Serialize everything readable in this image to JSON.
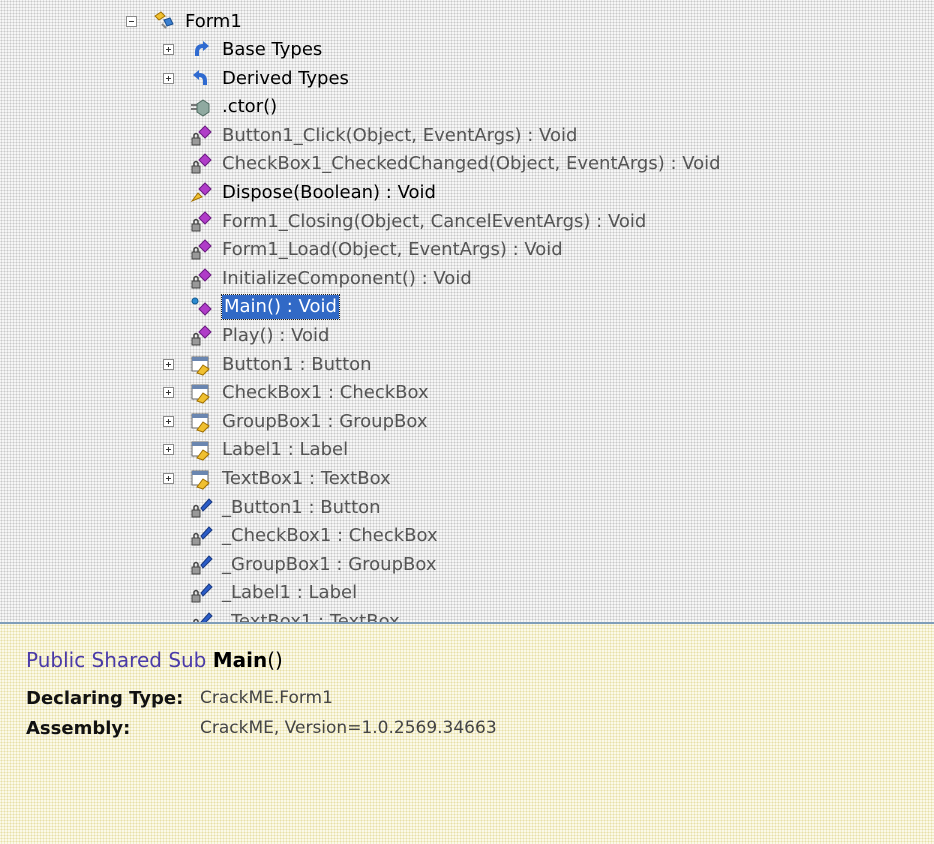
{
  "tree": {
    "root": {
      "label": "Form1",
      "icon": "class-icon",
      "expanded": true
    },
    "items": [
      {
        "label": "Base Types",
        "icon": "base-types-icon",
        "expander": "plus",
        "bold": true
      },
      {
        "label": "Derived Types",
        "icon": "derived-types-icon",
        "expander": "plus",
        "bold": true
      },
      {
        "label": ".ctor()",
        "icon": "constructor-icon",
        "bold": true
      },
      {
        "label": "Button1_Click(Object, EventArgs) : Void",
        "icon": "private-method-icon"
      },
      {
        "label": "CheckBox1_CheckedChanged(Object, EventArgs) : Void",
        "icon": "private-method-icon"
      },
      {
        "label": "Dispose(Boolean) : Void",
        "icon": "protected-method-icon",
        "bold": true
      },
      {
        "label": "Form1_Closing(Object, CancelEventArgs) : Void",
        "icon": "private-method-icon"
      },
      {
        "label": "Form1_Load(Object, EventArgs) : Void",
        "icon": "private-method-icon"
      },
      {
        "label": "InitializeComponent() : Void",
        "icon": "private-method-icon"
      },
      {
        "label": "Main() : Void",
        "icon": "static-method-icon",
        "selected": true
      },
      {
        "label": "Play() : Void",
        "icon": "private-method-icon"
      },
      {
        "label": "Button1 : Button",
        "icon": "property-icon",
        "expander": "plus"
      },
      {
        "label": "CheckBox1 : CheckBox",
        "icon": "property-icon",
        "expander": "plus"
      },
      {
        "label": "GroupBox1 : GroupBox",
        "icon": "property-icon",
        "expander": "plus"
      },
      {
        "label": "Label1 : Label",
        "icon": "property-icon",
        "expander": "plus"
      },
      {
        "label": "TextBox1 : TextBox",
        "icon": "property-icon",
        "expander": "plus"
      },
      {
        "label": "_Button1 : Button",
        "icon": "private-field-icon"
      },
      {
        "label": "_CheckBox1 : CheckBox",
        "icon": "private-field-icon"
      },
      {
        "label": "_GroupBox1 : GroupBox",
        "icon": "private-field-icon"
      },
      {
        "label": "_Label1 : Label",
        "icon": "private-field-icon"
      },
      {
        "label": "_TextBox1 : TextBox",
        "icon": "private-field-icon"
      }
    ]
  },
  "info": {
    "signature_keywords": "Public Shared Sub",
    "signature_name": "Main",
    "signature_parens": "()",
    "declaring_type_label": "Declaring Type:",
    "declaring_type_value": "CrackME.Form1",
    "assembly_label": "Assembly:",
    "assembly_value": "CrackME, Version=1.0.2569.34663"
  },
  "colors": {
    "selection": "#3169c6",
    "method_purple": "#b03cc8",
    "field_blue": "#2a5cc8",
    "signature_keyword": "#4a3aa8",
    "info_background": "#fbf9e8"
  }
}
